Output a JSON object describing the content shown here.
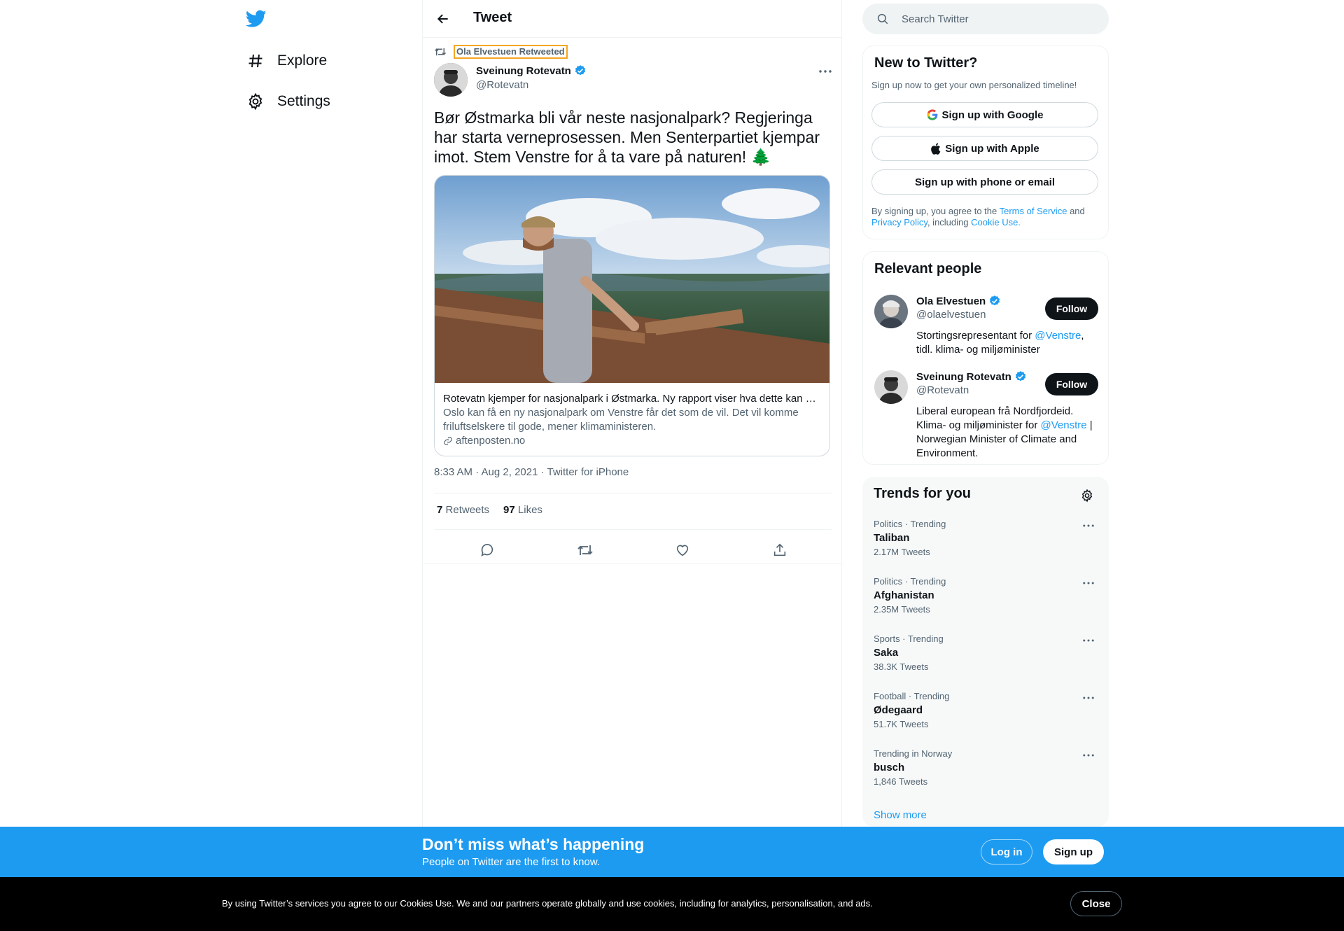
{
  "nav": {
    "explore_label": "Explore",
    "settings_label": "Settings"
  },
  "header": {
    "title": "Tweet"
  },
  "tweet": {
    "retweeted_by": "Ola Elvestuen Retweeted",
    "author_name": "Sveinung Rotevatn",
    "author_handle": "@Rotevatn",
    "text": "Bør Østmarka bli vår neste nasjonalpark? Regjeringa har starta verneprosessen. Men Senterpartiet kjempar imot. Stem Venstre for å ta vare på naturen! 🌲",
    "card": {
      "title": "Rotevatn kjemper for nasjonalpark i Østmarka. Ny rapport viser hva dette kan bety",
      "description": "Oslo kan få en ny nasjonalpark om Venstre får det som de vil. Det vil komme friluftselskere til gode, mener klimaministeren.",
      "domain": "aftenposten.no"
    },
    "timestamp": "8:33 AM · Aug 2, 2021 · Twitter for iPhone",
    "retweets_count": "7",
    "retweets_label": "Retweets",
    "likes_count": "97",
    "likes_label": "Likes"
  },
  "search": {
    "placeholder": "Search Twitter"
  },
  "signup": {
    "title": "New to Twitter?",
    "subtitle": "Sign up now to get your own personalized timeline!",
    "google_label": "Sign up with Google",
    "apple_label": "Sign up with Apple",
    "phone_label": "Sign up with phone or email",
    "legal_prefix": "By signing up, you agree to the",
    "terms_label": "Terms of Service",
    "legal_and": "and",
    "privacy_label": "Privacy Policy",
    "legal_including": ", including",
    "cookie_label": "Cookie Use."
  },
  "relevant": {
    "title": "Relevant people",
    "people": [
      {
        "name": "Ola Elvestuen",
        "handle": "@olaelvestuen",
        "follow_label": "Follow",
        "bio_a": "Stortingsrepresentant for",
        "bio_mention": "@Venstre",
        "bio_b": ",",
        "bio_c": "tidl. klima- og miljøminister"
      },
      {
        "name": "Sveinung Rotevatn",
        "handle": "@Rotevatn",
        "follow_label": "Follow",
        "bio_a": "Liberal european frå Nordfjordeid. Klima- og miljøminister for",
        "bio_mention": "@Venstre",
        "bio_b": "| Norwegian Minister of Climate and Environment."
      }
    ]
  },
  "trends": {
    "title": "Trends for you",
    "items": [
      {
        "category": "Politics · Trending",
        "name": "Taliban",
        "count": "2.17M Tweets"
      },
      {
        "category": "Politics · Trending",
        "name": "Afghanistan",
        "count": "2.35M Tweets"
      },
      {
        "category": "Sports · Trending",
        "name": "Saka",
        "count": "38.3K Tweets"
      },
      {
        "category": "Football · Trending",
        "name": "Ødegaard",
        "count": "51.7K Tweets"
      },
      {
        "category": "Trending in Norway",
        "name": "busch",
        "count": "1,846 Tweets"
      }
    ],
    "show_more": "Show more"
  },
  "banner": {
    "headline": "Don’t miss what’s happening",
    "subline": "People on Twitter are the first to know.",
    "login_label": "Log in",
    "signup_label": "Sign up"
  },
  "cookie": {
    "text": "By using Twitter’s services you agree to our Cookies Use. We and our partners operate globally and use cookies, including for analytics, personalisation, and ads.",
    "close_label": "Close"
  },
  "colors": {
    "brand": "#1d9bf0",
    "text": "#0f1419",
    "muted": "#536471"
  }
}
